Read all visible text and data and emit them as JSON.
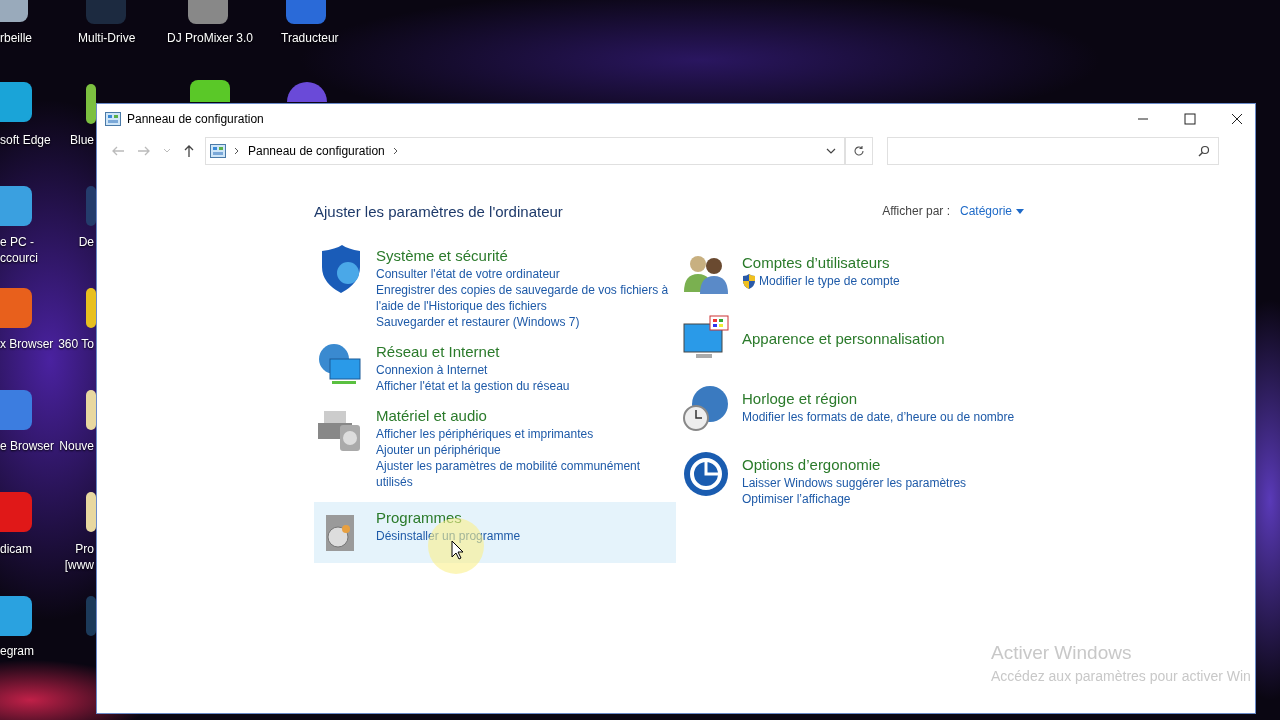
{
  "desktop_icons": [
    {
      "lines": [
        "rbeille"
      ]
    },
    {
      "lines": [
        "soft Edge"
      ]
    },
    {
      "lines": [
        "e PC -",
        "ccourci"
      ]
    },
    {
      "lines": [
        "x Browser"
      ]
    },
    {
      "lines": [
        "e Browser"
      ]
    },
    {
      "lines": [
        "dicam"
      ]
    },
    {
      "lines": [
        "egram"
      ]
    },
    {
      "lines": [
        "Multi-Drive"
      ]
    },
    {
      "lines": [
        "Blue"
      ]
    },
    {
      "lines": [
        "De"
      ]
    },
    {
      "lines": [
        "360 To"
      ]
    },
    {
      "lines": [
        "Nouve"
      ]
    },
    {
      "lines": [
        "Pro",
        "[www"
      ]
    },
    {
      "lines": [
        "DJ ProMixer 3.0"
      ]
    },
    {
      "lines": [
        "Traducteur"
      ]
    }
  ],
  "window": {
    "title": "Panneau de configuration",
    "address": {
      "crumb": "Panneau de configuration"
    },
    "heading": "Ajuster les paramètres de l'ordinateur",
    "view_by": {
      "label": "Afficher par :",
      "value": "Catégorie"
    },
    "columns": [
      [
        {
          "title": "Système et sécurité",
          "highlighted": false,
          "links": [
            {
              "text": "Consulter l'état de votre ordinateur",
              "kind": "plain"
            },
            {
              "text": "Enregistrer des copies de sauvegarde de vos fichiers à l'aide de l'Historique des fichiers",
              "kind": "plain"
            },
            {
              "text": "Sauvegarder et restaurer (Windows 7)",
              "kind": "plain"
            }
          ]
        },
        {
          "title": "Réseau et Internet",
          "highlighted": false,
          "links": [
            {
              "text": "Connexion à Internet",
              "kind": "plain"
            },
            {
              "text": "Afficher l'état et la gestion du réseau",
              "kind": "plain"
            }
          ]
        },
        {
          "title": "Matériel et audio",
          "highlighted": false,
          "links": [
            {
              "text": "Afficher les périphériques et imprimantes",
              "kind": "plain"
            },
            {
              "text": "Ajouter un périphérique",
              "kind": "plain"
            },
            {
              "text": "Ajuster les paramètres de mobilité communément utilisés",
              "kind": "plain"
            }
          ]
        },
        {
          "title": "Programmes",
          "highlighted": true,
          "links": [
            {
              "text": "Désinstaller un programme",
              "kind": "plain"
            }
          ]
        }
      ],
      [
        {
          "title": "Comptes d’utilisateurs",
          "highlighted": false,
          "links": [
            {
              "text": "Modifier le type de compte",
              "kind": "admin"
            }
          ]
        },
        {
          "title": "Apparence et personnalisation",
          "highlighted": false
        },
        {
          "title": "Horloge et région",
          "highlighted": false,
          "links": [
            {
              "text": "Modifier les formats de date, d’heure ou de nombre",
              "kind": "plain"
            }
          ]
        },
        {
          "title": "Options d’ergonomie",
          "highlighted": false,
          "links": [
            {
              "text": "Laisser Windows suggérer les paramètres",
              "kind": "plain"
            },
            {
              "text": "Optimiser l’affichage",
              "kind": "plain"
            }
          ]
        }
      ]
    ]
  },
  "activation": {
    "title": "Activer Windows",
    "text": "Accédez aux paramètres pour activer Win"
  }
}
